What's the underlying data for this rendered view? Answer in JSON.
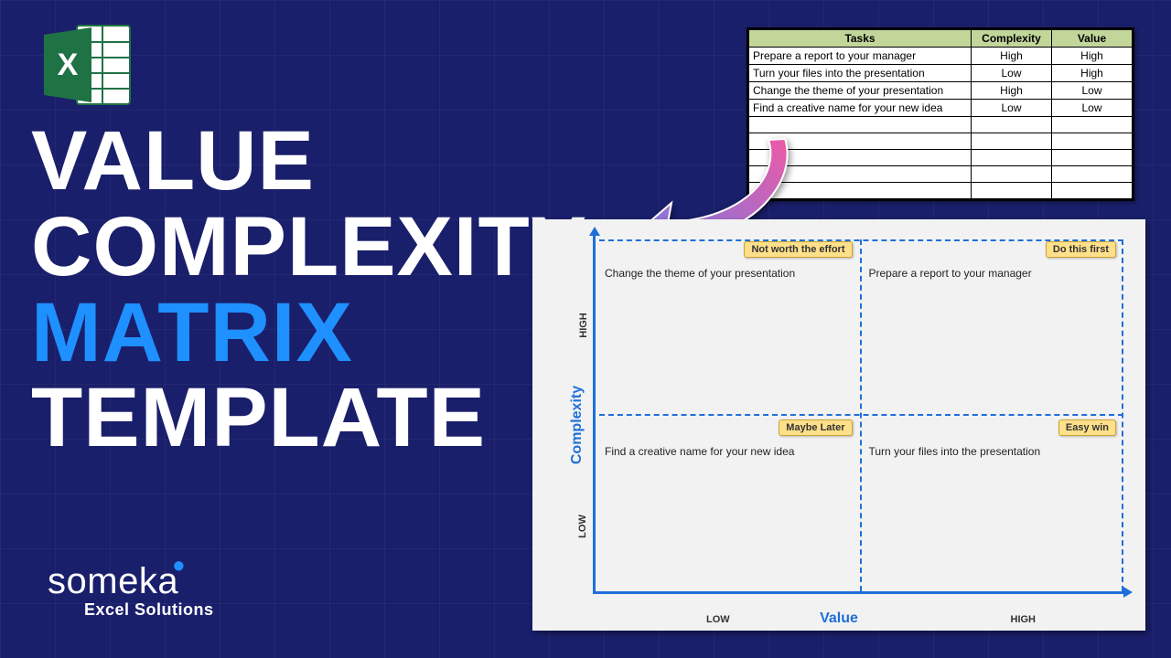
{
  "title": {
    "l1": "VALUE",
    "l2": "COMPLEXITY",
    "l3": "MATRIX",
    "l4": "TEMPLATE"
  },
  "brand": {
    "name": "someka",
    "sub": "Excel Solutions"
  },
  "table": {
    "headers": {
      "tasks": "Tasks",
      "complexity": "Complexity",
      "value": "Value"
    },
    "rows": [
      {
        "task": "Prepare a report to your manager",
        "complexity": "High",
        "value": "High"
      },
      {
        "task": "Turn your files into the presentation",
        "complexity": "Low",
        "value": "High"
      },
      {
        "task": "Change the theme of your presentation",
        "complexity": "High",
        "value": "Low"
      },
      {
        "task": "Find a creative name for your new idea",
        "complexity": "Low",
        "value": "Low"
      }
    ],
    "empty_rows": 5
  },
  "matrix": {
    "y_title": "Complexity",
    "x_title": "Value",
    "y_high": "HIGH",
    "y_low": "LOW",
    "x_high": "HIGH",
    "x_low": "LOW",
    "quadrants": {
      "tl": {
        "tag": "Not worth the effort",
        "item": "Change the theme of your presentation"
      },
      "tr": {
        "tag": "Do this first",
        "item": "Prepare a report to your manager"
      },
      "bl": {
        "tag": "Maybe Later",
        "item": "Find a creative name for your new idea"
      },
      "br": {
        "tag": "Easy win",
        "item": "Turn your files into the presentation"
      }
    }
  },
  "chart_data": {
    "type": "table",
    "description": "2x2 value-complexity quadrant chart",
    "x_axis": "Value",
    "y_axis": "Complexity",
    "x_categories": [
      "Low",
      "High"
    ],
    "y_categories": [
      "Low",
      "High"
    ],
    "cells": [
      {
        "value": "Low",
        "complexity": "High",
        "label": "Not worth the effort",
        "items": [
          "Change the theme of your presentation"
        ]
      },
      {
        "value": "High",
        "complexity": "High",
        "label": "Do this first",
        "items": [
          "Prepare a report to your manager"
        ]
      },
      {
        "value": "Low",
        "complexity": "Low",
        "label": "Maybe Later",
        "items": [
          "Find a creative name for your new idea"
        ]
      },
      {
        "value": "High",
        "complexity": "Low",
        "label": "Easy win",
        "items": [
          "Turn your files into the presentation"
        ]
      }
    ]
  }
}
